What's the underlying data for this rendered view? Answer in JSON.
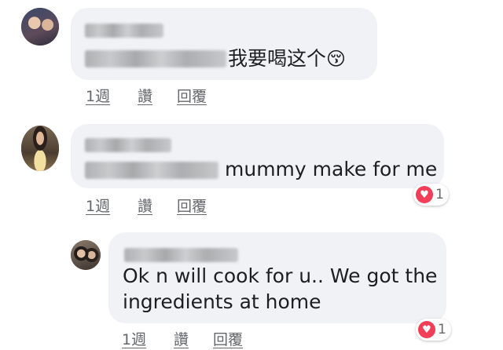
{
  "comments": [
    {
      "message": "我要喝这个",
      "emoji": "😚",
      "actions": {
        "time": "1週",
        "like": "讚",
        "reply": "回覆"
      }
    },
    {
      "message": "mummy make for me",
      "actions": {
        "time": "1週",
        "like": "讚",
        "reply": "回覆"
      },
      "reaction": {
        "icon": "heart-icon",
        "count": "1"
      }
    },
    {
      "message_line1": "Ok n will cook for u.. We got the",
      "message_line2": "ingredients at home",
      "actions": {
        "time": "1週",
        "like": "讚",
        "reply": "回覆"
      },
      "reaction": {
        "icon": "heart-icon",
        "count": "1"
      }
    }
  ],
  "colors": {
    "bubble": "#f0f2f5",
    "text": "#1c1e21",
    "meta": "#65676b",
    "heart": "#f33e58"
  }
}
